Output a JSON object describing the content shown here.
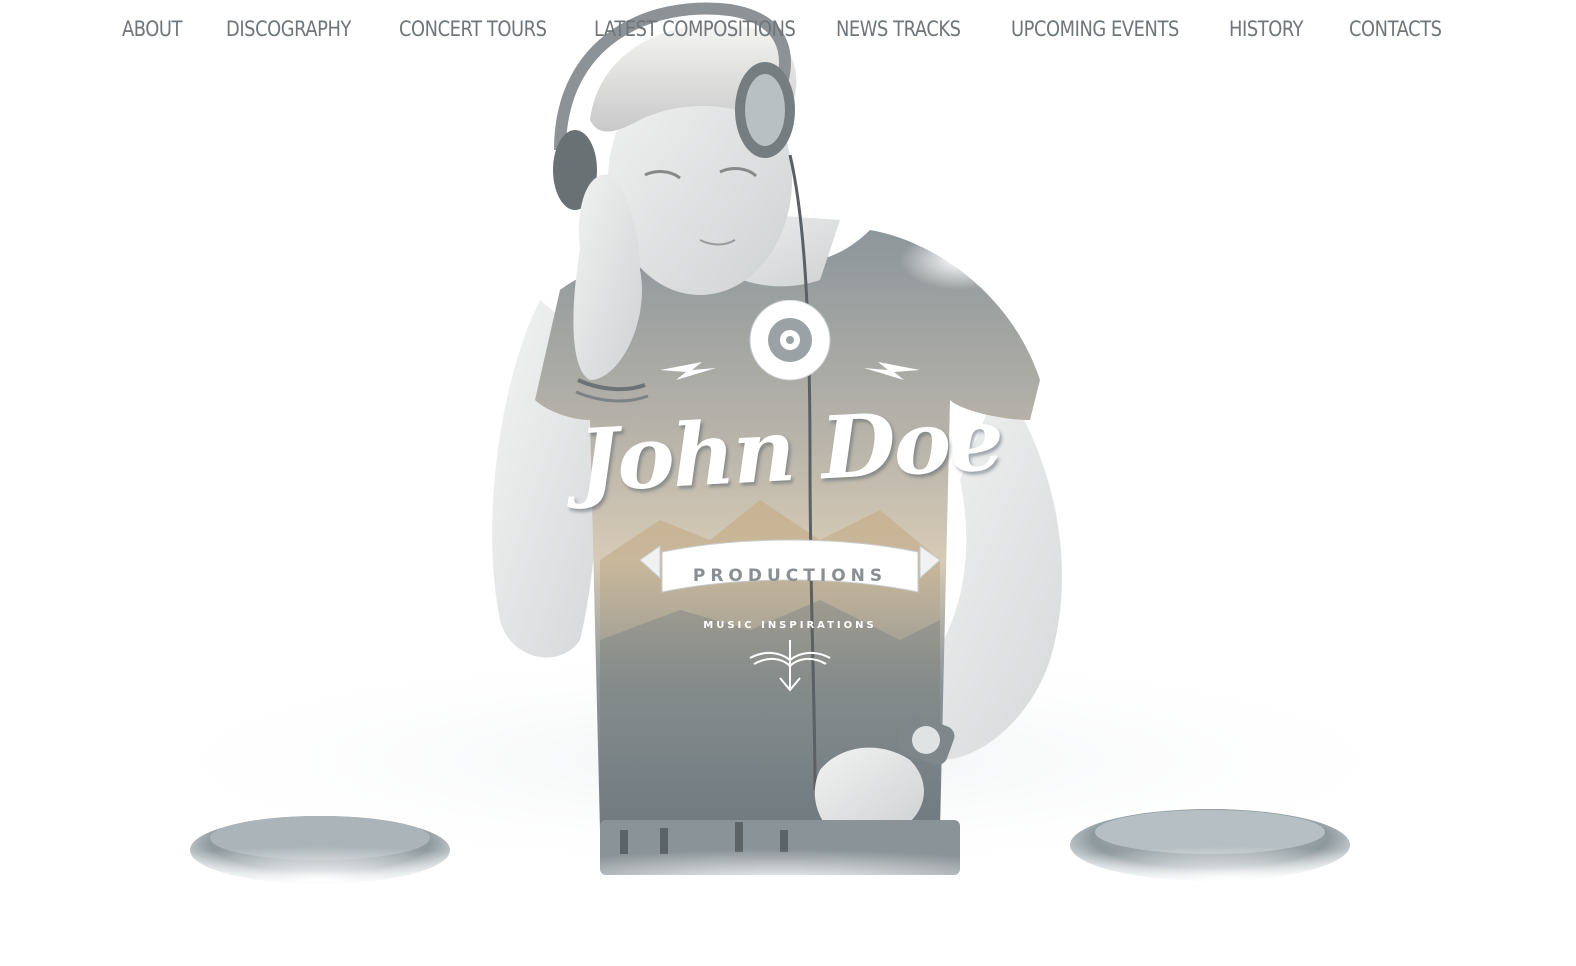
{
  "nav": {
    "items": [
      {
        "label": "ABOUT"
      },
      {
        "label": "DISCOGRAPHY"
      },
      {
        "label": "CONCERT TOURS"
      },
      {
        "label": "LATEST COMPOSITIONS"
      },
      {
        "label": "NEWS TRACKS"
      },
      {
        "label": "UPCOMING EVENTS"
      },
      {
        "label": "HISTORY"
      },
      {
        "label": "CONTACTS"
      }
    ]
  },
  "logo": {
    "name": "John Doe",
    "ribbon": "PRODUCTIONS",
    "tagline": "MUSIC INSPIRATIONS",
    "icons": [
      "vinyl-record-icon",
      "lightning-bolt-icon",
      "anchor-icon"
    ]
  },
  "hero": {
    "image": "dj-with-headphones-photo",
    "colors": {
      "nav_text": "#6f7579",
      "shirt": "#7e878c",
      "skin": "#dcdcdc",
      "background": "#ffffff"
    }
  }
}
